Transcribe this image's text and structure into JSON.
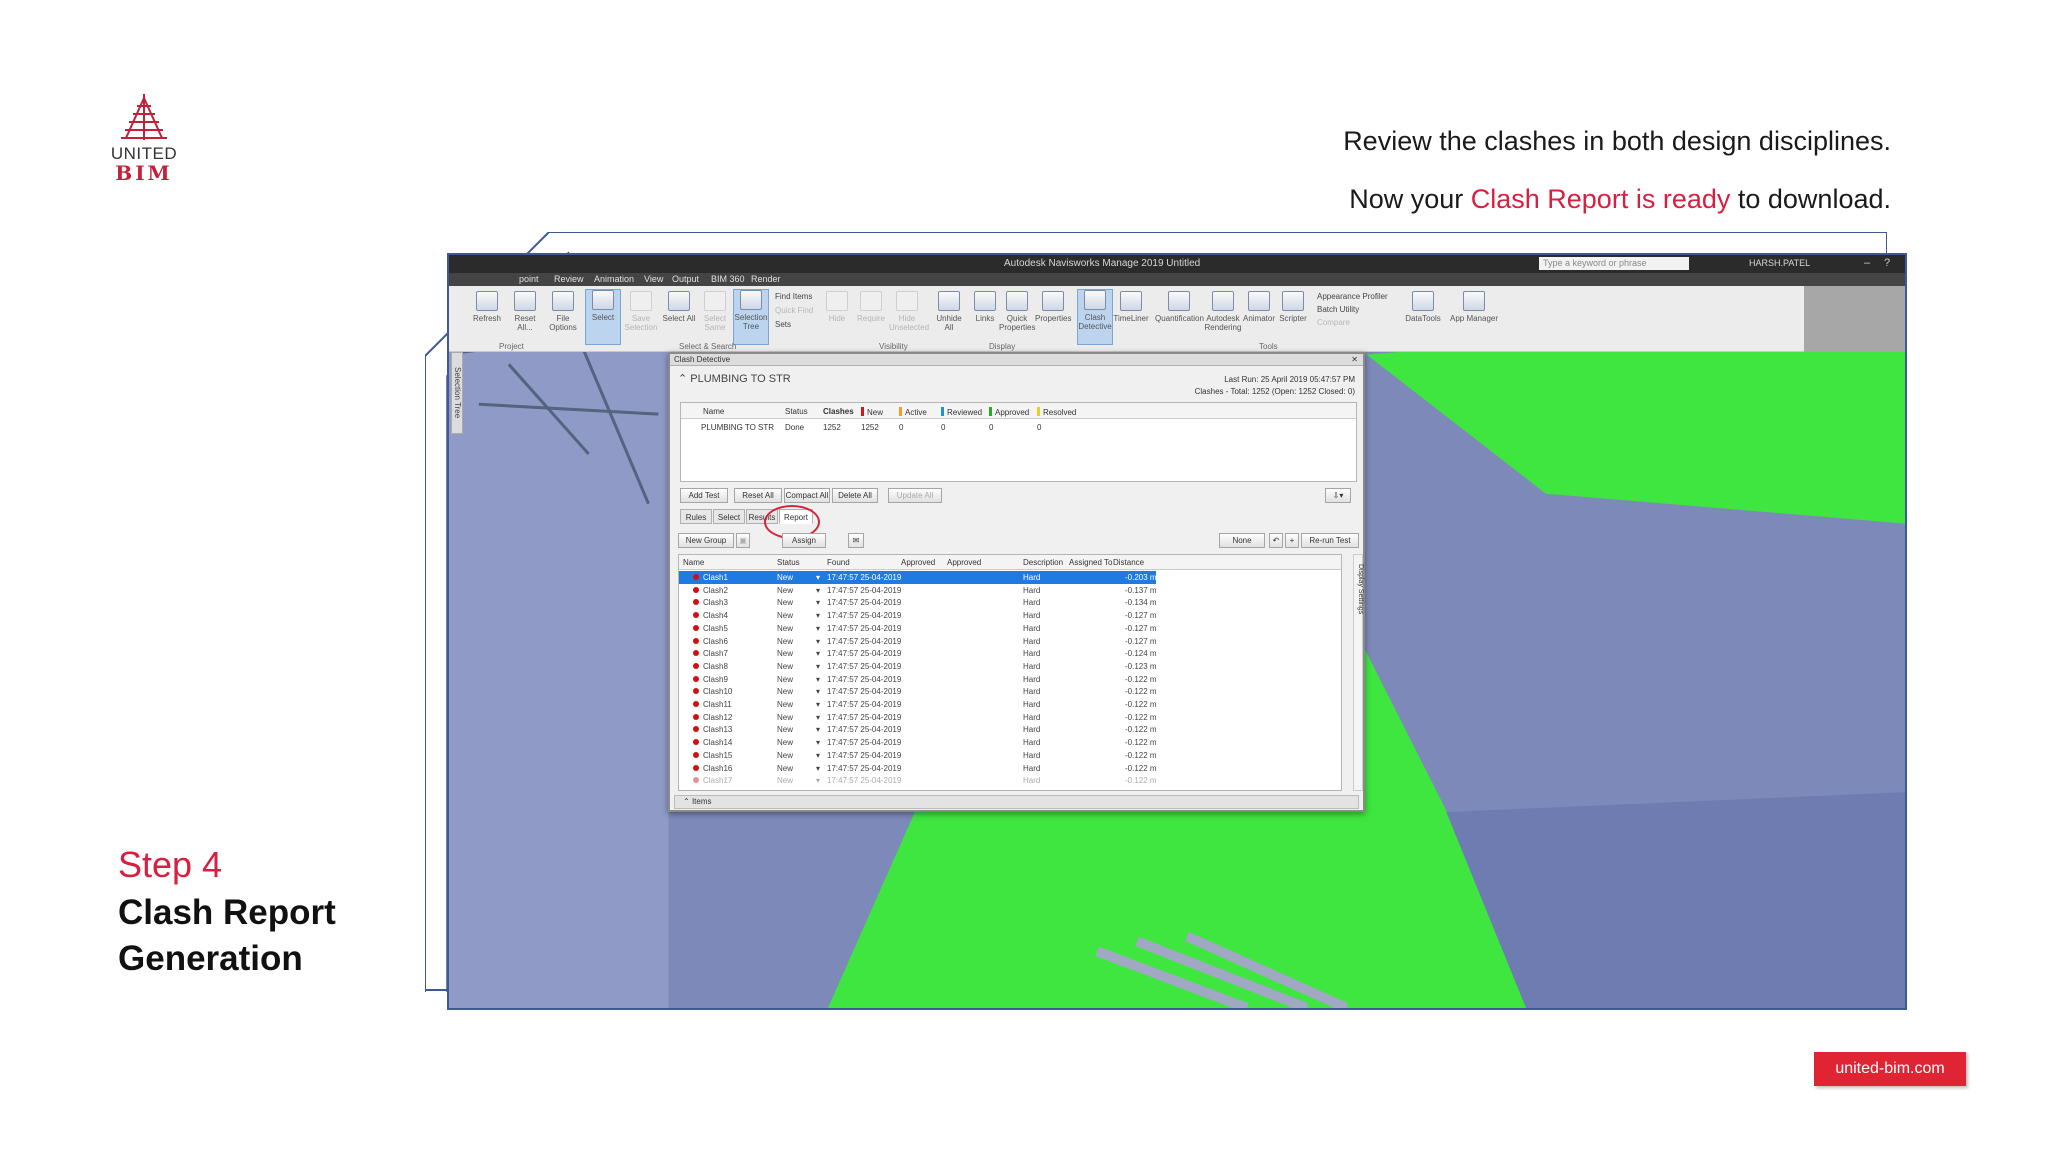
{
  "logo": {
    "line1": "UNITED",
    "line2": "BIM"
  },
  "headline": {
    "line1": "Review the clashes in both design disciplines.",
    "line2_pre": "Now your ",
    "line2_highlight": "Clash Report is ready",
    "line2_post": " to download."
  },
  "step": {
    "number": "Step 4",
    "title_line1": "Clash Report",
    "title_line2": "Generation"
  },
  "website": "united-bim.com",
  "app": {
    "window_title": "Autodesk Navisworks Manage 2019   Untitled",
    "search_placeholder": "Type a keyword or phrase",
    "user": "HARSH.PATEL",
    "menu": [
      "point",
      "Review",
      "Animation",
      "View",
      "Output",
      "BIM 360",
      "Render"
    ],
    "ribbon": {
      "buttons": [
        {
          "label": "Refresh"
        },
        {
          "label": "Reset All..."
        },
        {
          "label": "File Options"
        },
        {
          "label": "Select"
        },
        {
          "label": "Save Selection"
        },
        {
          "label": "Select All"
        },
        {
          "label": "Select Same"
        },
        {
          "label": "Selection Tree"
        },
        {
          "label": "Hide"
        },
        {
          "label": "Require"
        },
        {
          "label": "Hide Unselected"
        },
        {
          "label": "Unhide All"
        },
        {
          "label": "Links"
        },
        {
          "label": "Quick Properties"
        },
        {
          "label": "Properties"
        },
        {
          "label": "Clash Detective"
        },
        {
          "label": "TimeLiner"
        },
        {
          "label": "Quantification"
        },
        {
          "label": "Autodesk Rendering"
        },
        {
          "label": "Animator"
        },
        {
          "label": "Scripter"
        },
        {
          "label": "DataTools"
        },
        {
          "label": "App Manager"
        }
      ],
      "small": {
        "find_items": "Find Items",
        "quick_find": "Quick Find",
        "sets": "Sets",
        "appearance_profiler": "Appearance Profiler",
        "batch_utility": "Batch Utility",
        "compare": "Compare"
      },
      "groups": {
        "project": "Project",
        "select_search": "Select & Search",
        "visibility": "Visibility",
        "display": "Display",
        "tools": "Tools"
      }
    },
    "side_tab": "Selection Tree",
    "clash": {
      "panel_title": "Clash Detective",
      "test_name": "PLUMBING TO STR",
      "last_run": "Last Run: 25 April 2019 05:47:57 PM",
      "summary": "Clashes - Total: 1252  (Open: 1252  Closed: 0)",
      "test_columns": [
        "Name",
        "Status",
        "Clashes",
        "New",
        "Active",
        "Reviewed",
        "Approved",
        "Resolved"
      ],
      "test_row": [
        "PLUMBING TO STR",
        "Done",
        "1252",
        "1252",
        "0",
        "0",
        "0",
        "0"
      ],
      "status_colors": {
        "new": "#d01818",
        "active": "#f0a020",
        "reviewed": "#1f8fd8",
        "approved": "#22b022",
        "resolved": "#e8d020"
      },
      "buttons": {
        "add_test": "Add Test",
        "reset_all": "Reset All",
        "compact_all": "Compact All",
        "delete_all": "Delete All",
        "update_all": "Update All"
      },
      "tabs": [
        "Rules",
        "Select",
        "Results",
        "Report"
      ],
      "toolbar": {
        "new_group": "New Group",
        "assign": "Assign",
        "none": "None",
        "rerun": "Re-run Test"
      },
      "result_columns": [
        "Name",
        "Status",
        "Found",
        "Approved",
        "Approved",
        "Description",
        "Assigned To",
        "Distance"
      ],
      "results": [
        {
          "name": "Clash1",
          "status": "New",
          "found": "17:47:57 25-04-2019",
          "desc": "Hard",
          "dist": "-0.203 m"
        },
        {
          "name": "Clash2",
          "status": "New",
          "found": "17:47:57 25-04-2019",
          "desc": "Hard",
          "dist": "-0.137 m"
        },
        {
          "name": "Clash3",
          "status": "New",
          "found": "17:47:57 25-04-2019",
          "desc": "Hard",
          "dist": "-0.134 m"
        },
        {
          "name": "Clash4",
          "status": "New",
          "found": "17:47:57 25-04-2019",
          "desc": "Hard",
          "dist": "-0.127 m"
        },
        {
          "name": "Clash5",
          "status": "New",
          "found": "17:47:57 25-04-2019",
          "desc": "Hard",
          "dist": "-0.127 m"
        },
        {
          "name": "Clash6",
          "status": "New",
          "found": "17:47:57 25-04-2019",
          "desc": "Hard",
          "dist": "-0.127 m"
        },
        {
          "name": "Clash7",
          "status": "New",
          "found": "17:47:57 25-04-2019",
          "desc": "Hard",
          "dist": "-0.124 m"
        },
        {
          "name": "Clash8",
          "status": "New",
          "found": "17:47:57 25-04-2019",
          "desc": "Hard",
          "dist": "-0.123 m"
        },
        {
          "name": "Clash9",
          "status": "New",
          "found": "17:47:57 25-04-2019",
          "desc": "Hard",
          "dist": "-0.122 m"
        },
        {
          "name": "Clash10",
          "status": "New",
          "found": "17:47:57 25-04-2019",
          "desc": "Hard",
          "dist": "-0.122 m"
        },
        {
          "name": "Clash11",
          "status": "New",
          "found": "17:47:57 25-04-2019",
          "desc": "Hard",
          "dist": "-0.122 m"
        },
        {
          "name": "Clash12",
          "status": "New",
          "found": "17:47:57 25-04-2019",
          "desc": "Hard",
          "dist": "-0.122 m"
        },
        {
          "name": "Clash13",
          "status": "New",
          "found": "17:47:57 25-04-2019",
          "desc": "Hard",
          "dist": "-0.122 m"
        },
        {
          "name": "Clash14",
          "status": "New",
          "found": "17:47:57 25-04-2019",
          "desc": "Hard",
          "dist": "-0.122 m"
        },
        {
          "name": "Clash15",
          "status": "New",
          "found": "17:47:57 25-04-2019",
          "desc": "Hard",
          "dist": "-0.122 m"
        },
        {
          "name": "Clash16",
          "status": "New",
          "found": "17:47:57 25-04-2019",
          "desc": "Hard",
          "dist": "-0.122 m"
        },
        {
          "name": "Clash17",
          "status": "New",
          "found": "17:47:57 25-04-2019",
          "desc": "Hard",
          "dist": "-0.122 m"
        }
      ],
      "footer": "Items"
    }
  },
  "colors": {
    "brand_red": "#d81f3f",
    "frame_blue": "#3e5a93",
    "scene_blue": "#7d8ab9",
    "scene_green": "#3fe63f",
    "selection_blue": "#1f7be0"
  }
}
